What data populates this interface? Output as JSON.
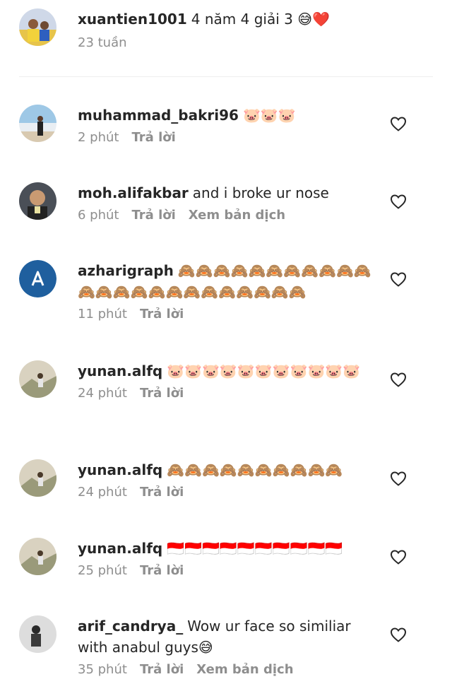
{
  "top_comment": {
    "username": "xuantien1001",
    "text": "4 năm 4 giải 3",
    "emoji": "😅❤️",
    "time": "23 tuần"
  },
  "comments": [
    {
      "username": "muhammad_bakri96",
      "text": "",
      "emoji": "🐷🐷🐷",
      "time": "2 phút",
      "reply": "Trả lời",
      "translate": ""
    },
    {
      "username": "moh.alifakbar",
      "text": "and i broke ur nose",
      "emoji": "",
      "time": "6 phút",
      "reply": "Trả lời",
      "translate": "Xem bản dịch"
    },
    {
      "username": "azharigraph",
      "text": "",
      "emoji": "🙈🙈🙈🙈🙈🙈🙈🙈🙈🙈🙈🙈🙈🙈🙈🙈🙈🙈🙈🙈🙈🙈🙈🙈",
      "time": "11 phút",
      "reply": "Trả lời",
      "translate": ""
    },
    {
      "username": "yunan.alfq",
      "text": "",
      "emoji": "🐷🐷🐷🐷🐷🐷🐷🐷🐷🐷🐷",
      "time": "24 phút",
      "reply": "Trả lời",
      "translate": ""
    },
    {
      "username": "yunan.alfq",
      "text": "",
      "emoji": "🙈🙈🙈🙈🙈🙈🙈🙈🙈🙈",
      "time": "24 phút",
      "reply": "Trả lời",
      "translate": ""
    },
    {
      "username": "yunan.alfq",
      "text": "",
      "emoji": "🇮🇩🇮🇩🇮🇩🇮🇩🇮🇩🇮🇩🇮🇩🇮🇩🇮🇩🇮🇩",
      "time": "25 phút",
      "reply": "Trả lời",
      "translate": ""
    },
    {
      "username": "arif_candrya_",
      "text": "Wow ur face so similiar with anabul guys",
      "emoji": "😅",
      "time": "35 phút",
      "reply": "Trả lời",
      "translate": "Xem bản dịch"
    }
  ],
  "colors": {
    "text": "#262626",
    "meta": "#8e8e8e",
    "avatar_blue": "#1f5f9e",
    "divider": "#eeeeee"
  },
  "icons": {
    "like": "heart-outline-icon",
    "brand_avatar": "letter-a-logo"
  }
}
